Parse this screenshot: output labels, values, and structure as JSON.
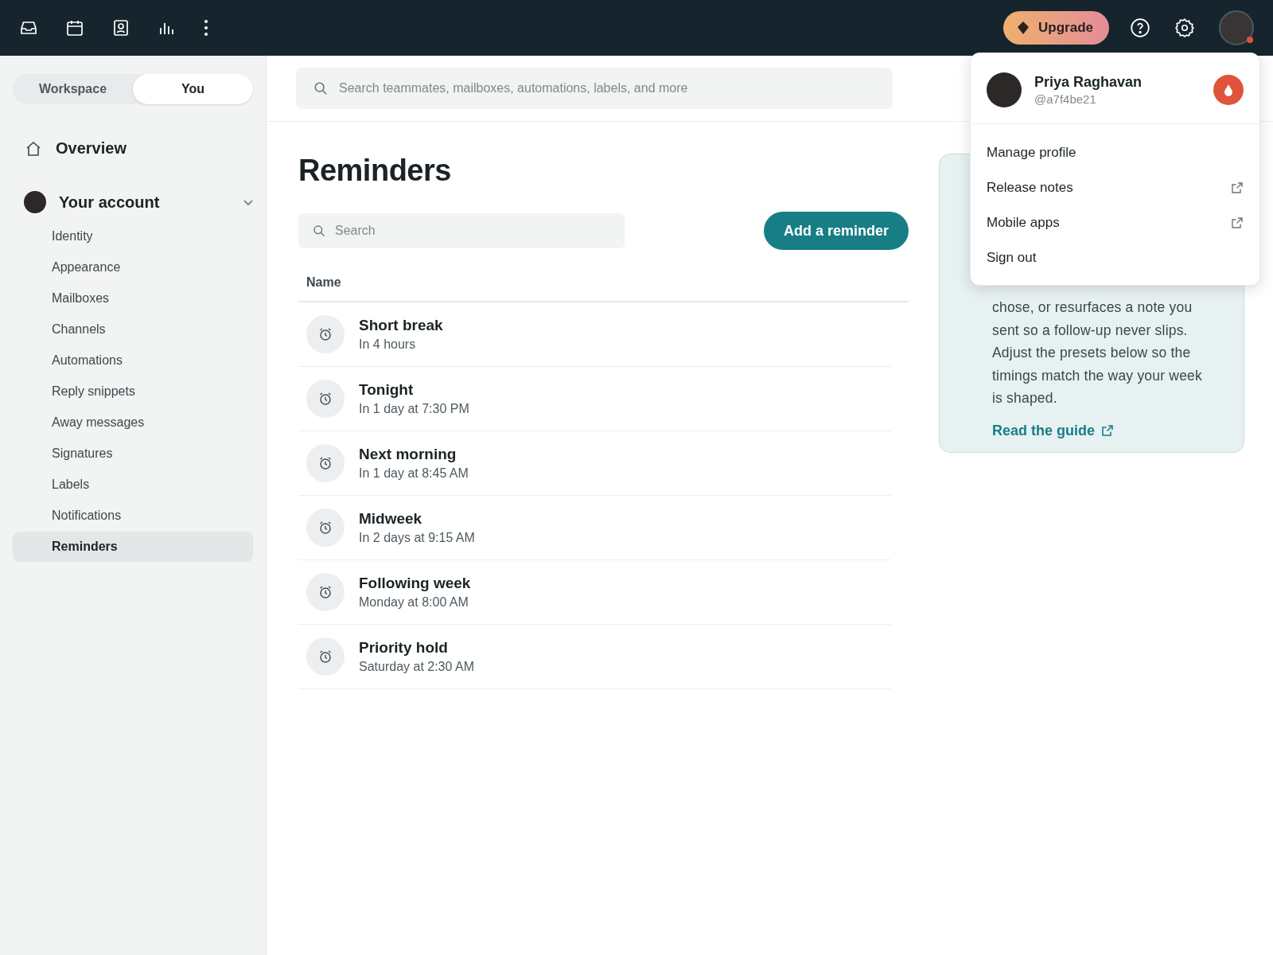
{
  "topbar": {
    "upgrade_label": "Upgrade"
  },
  "sidebar": {
    "segments": [
      {
        "label": "Workspace",
        "selected": false
      },
      {
        "label": "You",
        "selected": true
      }
    ],
    "overview": "Overview",
    "account": {
      "label": "Your account",
      "expanded": true,
      "items": [
        {
          "label": "Identity",
          "selected": false
        },
        {
          "label": "Appearance",
          "selected": false
        },
        {
          "label": "Mailboxes",
          "selected": false
        },
        {
          "label": "Channels",
          "selected": false
        },
        {
          "label": "Automations",
          "selected": false
        },
        {
          "label": "Reply snippets",
          "selected": false
        },
        {
          "label": "Away messages",
          "selected": false
        },
        {
          "label": "Signatures",
          "selected": false
        },
        {
          "label": "Labels",
          "selected": false
        },
        {
          "label": "Notifications",
          "selected": false
        },
        {
          "label": "Reminders",
          "selected": true
        }
      ]
    }
  },
  "search": {
    "placeholder": "Search teammates, mailboxes, automations, labels, and more"
  },
  "page": {
    "title": "Reminders",
    "list_search": {
      "placeholder": "Search"
    },
    "add_button": "Add a reminder",
    "column": "Name",
    "reminders": [
      {
        "name": "Short break",
        "when": "In 4 hours"
      },
      {
        "name": "Tonight",
        "when": "In 1 day at 7:30 PM"
      },
      {
        "name": "Next morning",
        "when": "In 1 day at 8:45 AM"
      },
      {
        "name": "Midweek",
        "when": "In 2 days at 9:15 AM"
      },
      {
        "name": "Following week",
        "when": "Monday at 8:00 AM"
      },
      {
        "name": "Priority hold",
        "when": "Saturday at 2:30 AM"
      }
    ]
  },
  "info_panel": {
    "text": "chose, or resurfaces a note you sent so a follow-up never slips. Adjust the presets below so the timings match the way your week is shaped.",
    "link": "Read the guide"
  },
  "profile_menu": {
    "name": "Priya Raghavan",
    "handle": "@a7f4be21",
    "items": [
      {
        "label": "Manage profile",
        "external": false
      },
      {
        "label": "Release notes",
        "external": true
      },
      {
        "label": "Mobile apps",
        "external": true
      },
      {
        "label": "Sign out",
        "external": false
      }
    ]
  }
}
